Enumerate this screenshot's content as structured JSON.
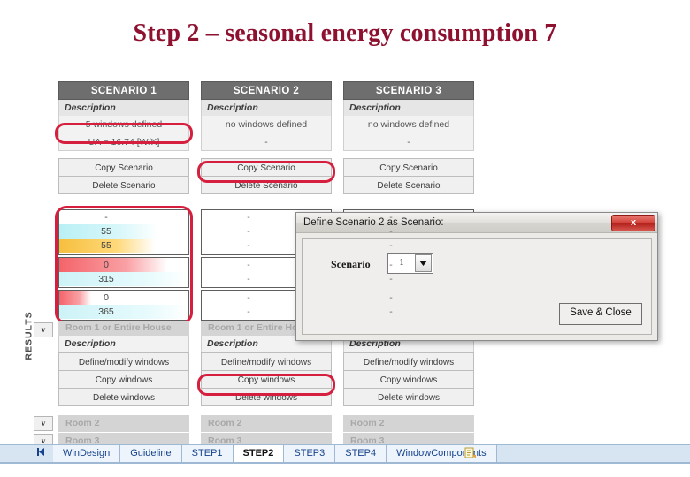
{
  "slide": {
    "title": "Step 2 – seasonal energy consumption 7",
    "title_color": "#8e1230"
  },
  "results_label": "RESULTS",
  "scenarios": [
    {
      "header": "SCENARIO 1",
      "description_label": "Description",
      "description_value": "5 windows defined",
      "ua_value": "UA = 16.74 [W/K]",
      "copy_label": "Copy Scenario",
      "delete_label": "Delete Scenario",
      "highlight_description": true,
      "highlight_copy": false,
      "highlight_results": true
    },
    {
      "header": "SCENARIO 2",
      "description_label": "Description",
      "description_value": "no windows defined",
      "ua_value": "-",
      "copy_label": "Copy Scenario",
      "delete_label": "Delete Scenario",
      "highlight_description": false,
      "highlight_copy": true,
      "highlight_results": false
    },
    {
      "header": "SCENARIO 3",
      "description_label": "Description",
      "description_value": "no windows defined",
      "ua_value": "-",
      "copy_label": "Copy Scenario",
      "delete_label": "Delete Scenario",
      "highlight_description": false,
      "highlight_copy": false,
      "highlight_results": false
    }
  ],
  "results": {
    "scenario1": {
      "group1": [
        "-",
        "55",
        "55"
      ],
      "group2": [
        "0",
        "315"
      ],
      "group3": [
        "0",
        "365"
      ]
    },
    "scenario2": {
      "group1": [
        "-",
        "-",
        "-"
      ],
      "group2": [
        "-",
        "-"
      ],
      "group3": [
        "-",
        "-"
      ]
    },
    "scenario3": {
      "group1": [
        "-",
        "-",
        "-"
      ],
      "group2": [
        "-",
        "-"
      ],
      "group3": [
        "-",
        "-"
      ]
    }
  },
  "rooms": {
    "room1_header": "Room 1 or Entire House",
    "description_label": "Description",
    "define_label": "Define/modify windows",
    "copy_label": "Copy windows",
    "delete_label": "Delete windows",
    "room2_label": "Room 2",
    "room3_label": "Room 3",
    "expand_glyph": "v"
  },
  "dialog": {
    "title": "Define Scenario 2 as Scenario:",
    "close_glyph": "x",
    "scenario_label": "Scenario",
    "scenario_value": "1",
    "dropdown_glyph": "▼",
    "save_label": "Save & Close"
  },
  "tabbar": {
    "nav_glyph": "◄|",
    "tabs": [
      {
        "label": "WinDesign",
        "active": false
      },
      {
        "label": "Guideline",
        "active": false
      },
      {
        "label": "STEP1",
        "active": false
      },
      {
        "label": "STEP2",
        "active": true
      },
      {
        "label": "STEP3",
        "active": false
      },
      {
        "label": "STEP4",
        "active": false
      },
      {
        "label": "WindowComponents",
        "active": false
      }
    ]
  }
}
